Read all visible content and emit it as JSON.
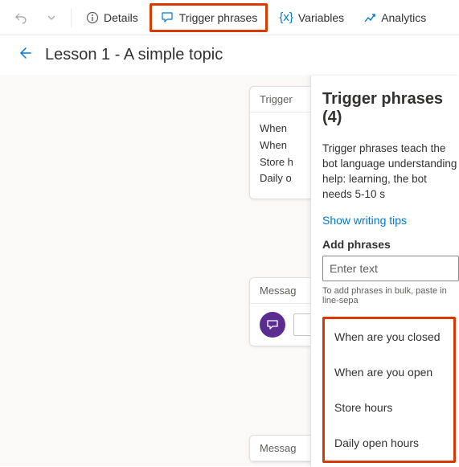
{
  "toolbar": {
    "details": "Details",
    "trigger": "Trigger phrases",
    "variables": "Variables",
    "analytics": "Analytics"
  },
  "header": {
    "title": "Lesson 1 - A simple topic"
  },
  "trigger_card": {
    "header": "Trigger",
    "lines": [
      "When",
      "When",
      "Store h",
      "Daily o"
    ]
  },
  "message_card": {
    "header": "Messag"
  },
  "message_card2": {
    "header": "Messag"
  },
  "panel": {
    "title": "Trigger phrases (4)",
    "desc": "Trigger phrases teach the bot language understanding help: learning, the bot needs 5-10 s",
    "tips_link": "Show writing tips",
    "add_label": "Add phrases",
    "input_placeholder": "Enter text",
    "hint": "To add phrases in bulk, paste in line-sepa",
    "phrases": [
      "When are you closed",
      "When are you open",
      "Store hours",
      "Daily open hours"
    ]
  }
}
